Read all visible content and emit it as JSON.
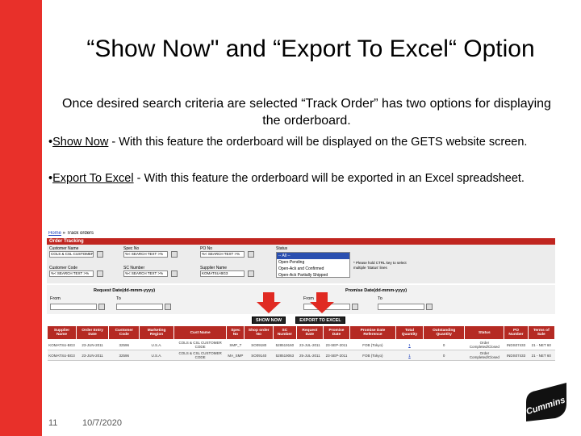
{
  "slide": {
    "title": "“Show Now\" and “Export To Excel“ Option",
    "intro": "Once desired search criteria are selected “Track Order” has two options for displaying the orderboard.",
    "bullets": [
      {
        "term": "Show Now",
        "text": " - With this feature the orderboard will be displayed on the GETS website screen."
      },
      {
        "term": "Export To Excel",
        "text": " - With this feature the orderboard will be exported in an Excel spreadsheet."
      }
    ],
    "page_number": "11",
    "date": "10/7/2020",
    "logo_text": "Cummins"
  },
  "colors": {
    "brand_red": "#e8302a",
    "header_red": "#c0251f"
  },
  "screenshot": {
    "breadcrumb": {
      "home": "Home",
      "sep": " » ",
      "current": "Track orders"
    },
    "header": "Order Tracking",
    "fields": {
      "customer_name": {
        "label": "Customer Name",
        "value": "COLS & CSL CUSTOMER"
      },
      "spec_no": {
        "label": "Spec No",
        "value": "%< SEARCH TEXT >%"
      },
      "po_no": {
        "label": "PO No",
        "value": "%< SEARCH TEXT >%"
      },
      "customer_code": {
        "label": "Customer Code",
        "value": "%< SEARCH TEXT >%"
      },
      "sc_number": {
        "label": "SC Number",
        "value": "%< SEARCH TEXT >%"
      },
      "supplier_name": {
        "label": "Supplier Name",
        "value": "KOMATSU-BG3"
      },
      "status": {
        "label": "Status",
        "options": [
          "-- All --",
          "Open-Pending",
          "Open-Ack and Confirmed",
          "Open-Ack Partially Shipped"
        ],
        "selected": "-- All --"
      }
    },
    "note": "* Please hold CTRL key to select multiple 'Status' lines",
    "dates": {
      "request_label": "Request Date(dd-mmm-yyyy)",
      "promise_label": "Promise Date(dd-mmm-yyyy)",
      "from": "From",
      "to": "To"
    },
    "buttons": {
      "show_now": "SHOW NOW",
      "export": "EXPORT TO EXCEL"
    },
    "table": {
      "headers": [
        "Supplier Name",
        "Order Entry Date",
        "Customer Code",
        "Marketing Region",
        "Cust Name",
        "Spec No",
        "Shop order No",
        "SC Number",
        "Request Date",
        "Promise Date",
        "Promise Date Reference",
        "Total Quantity",
        "Outstanding Quantity",
        "Status",
        "PO Number",
        "Terms of Sale"
      ],
      "rows": [
        [
          "KOMATSU-BG3",
          "23-JUN-2011",
          "32596",
          "U.S.A.",
          "COLS & CSL CUSTOMER CODE",
          "SMP_T",
          "SO09180",
          "528519160",
          "23-JUL-2011",
          "23-SEP-2011",
          "FOB (Tokyo)",
          "1",
          "0",
          "Order Completed/Closed",
          "INDS07433",
          "21 - NET 60"
        ],
        [
          "KOMATSU-BG3",
          "23-JUN-2011",
          "32596",
          "U.S.A.",
          "COLS & CSL CUSTOMER CODE",
          "MA_SMP",
          "SO09140",
          "528519063",
          "25-JUL-2011",
          "23-SEP-2011",
          "FOB (Tokyo)",
          "1",
          "0",
          "Order Completed/Closed",
          "INDS07433",
          "21 - NET 60"
        ]
      ]
    }
  }
}
